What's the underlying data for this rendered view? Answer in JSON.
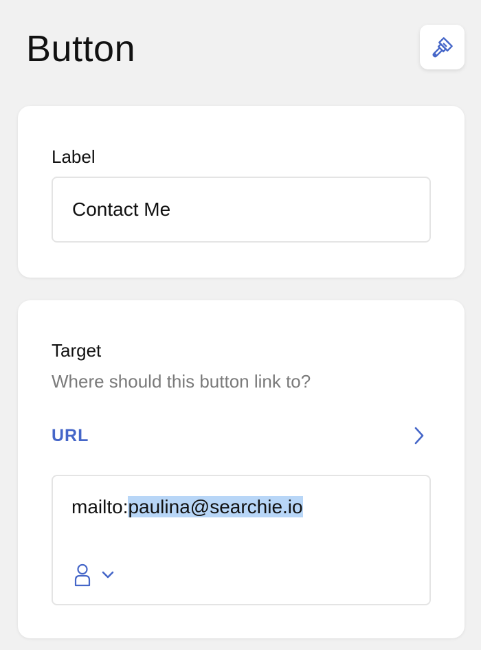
{
  "header": {
    "title": "Button"
  },
  "label_section": {
    "label": "Label",
    "value": "Contact Me"
  },
  "target_section": {
    "label": "Target",
    "help_text": "Where should this button link to?",
    "type": "URL",
    "url_prefix": "mailto:",
    "url_selected": "paulina@searchie.io"
  },
  "icons": {
    "style": "paintbrush-icon",
    "type_chevron": "chevron-right-icon",
    "variable": "user-icon",
    "variable_chevron": "chevron-down-icon"
  },
  "colors": {
    "background": "#f1f1f1",
    "card": "#ffffff",
    "accent": "#4566c8",
    "selection": "#b8d6f7",
    "muted_text": "#7a7a7a"
  }
}
